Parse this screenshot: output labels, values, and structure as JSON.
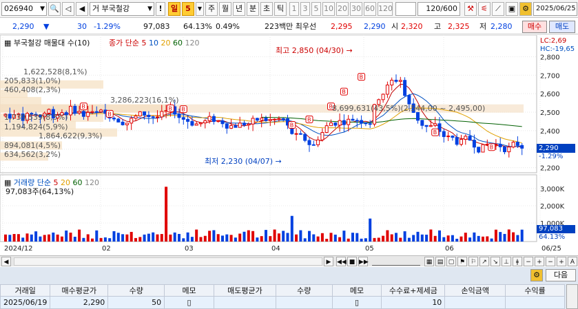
{
  "toolbar": {
    "code": "026940",
    "name": "부국철강",
    "name_prefix": "거",
    "period_buttons": [
      "일",
      "5",
      "주",
      "월",
      "년",
      "분",
      "초",
      "틱"
    ],
    "selected_period": "일",
    "selected_n": "5",
    "tick_buttons": [
      "1",
      "3",
      "5",
      "10",
      "20",
      "30",
      "60",
      "120"
    ],
    "count": "120/600",
    "date": "2025/06/25"
  },
  "quote": {
    "price": "2,290",
    "change": "30",
    "change_pct": "-1.29%",
    "volume": "97,083",
    "vol_ratio": "64.13%",
    "turnover": "0.49%",
    "broker_info": "223백만 최우선",
    "ask": "2,295",
    "bid": "2,290",
    "open_label": "시",
    "open": "2,320",
    "high_label": "고",
    "high": "2,325",
    "low_label": "저",
    "low": "2,280",
    "buy_label": "매수",
    "sell_label": "매도"
  },
  "price_panel": {
    "legend_name": "부국철강 매물대 수(10)",
    "ma_label": "종가 단순",
    "ma_periods": [
      "5",
      "10",
      "20",
      "60",
      "120"
    ],
    "lc": "LC:2,69",
    "hc": "HC:-19,65",
    "annot_high": "최고 2,850 (04/30)",
    "annot_low": "최저 2,230 (04/07)",
    "profile_labels": [
      "1,622,528(8,1%)",
      "205,833(1,0%)",
      "460,408(2,3%)",
      "3,286,223(16,1%)",
      "1,739,539(8,5%)",
      "1,194,824(5,9%)",
      "1,864,622(9,3%)",
      "894,081(4,5%)",
      "634,562(3,2%)",
      "8,699,631(43,5%)(2,544,00 ~ 2,495,00)"
    ],
    "y_ticks": [
      "2,800",
      "2,700",
      "2,600",
      "2,500",
      "2,400",
      "2,300",
      "2,200"
    ],
    "current_price_tag": "2,290",
    "current_pct_tag": "-1.29%"
  },
  "volume_panel": {
    "legend_label": "거래량",
    "ma_label": "단순",
    "ma_periods": [
      "5",
      "20",
      "60",
      "120"
    ],
    "current": "97,083주(64,13%)",
    "y_ticks": [
      "3,000K",
      "2,000K",
      "1,000K"
    ],
    "tag_value": "97,083",
    "tag_pct": "64.13%"
  },
  "x_axis": [
    "2024/12",
    "02",
    "03",
    "04",
    "05",
    "06",
    "06/25"
  ],
  "trade_table": {
    "next_label": "다음",
    "headers": [
      "거래일",
      "매수평균가",
      "수량",
      "메모",
      "매도평균가",
      "수량",
      "메모",
      "수수료+제세금",
      "손익금액",
      "수익률"
    ],
    "rows": [
      [
        "2025/06/19",
        "2,290",
        "50",
        "",
        "",
        "",
        "",
        "10",
        "",
        ""
      ]
    ]
  },
  "colors": {
    "up": "#e00000",
    "down": "#0040e0",
    "accent": "#ffcc33"
  }
}
